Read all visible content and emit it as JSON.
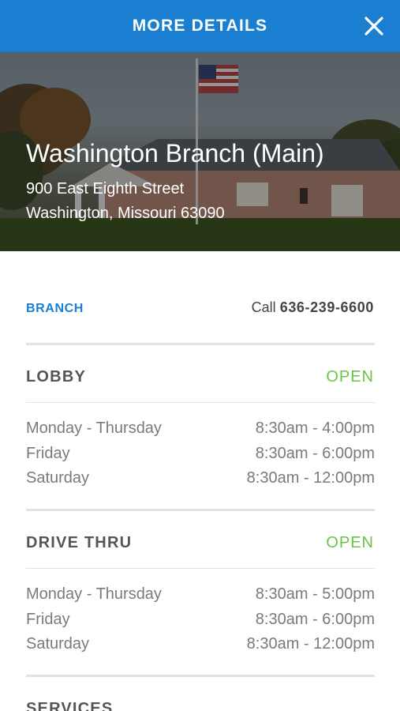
{
  "header": {
    "title": "MORE DETAILS",
    "close_icon": "close-icon"
  },
  "branch": {
    "name": "Washington Branch (Main)",
    "address_line1": "900 East Eighth Street",
    "address_line2": "Washington, Missouri 63090",
    "tag": "BRANCH",
    "call_label": "Call",
    "phone": "636-239-6600"
  },
  "colors": {
    "accent": "#1a7fd0",
    "open": "#6cc24a",
    "text": "#555555",
    "muted": "#7a7a7a",
    "divider": "#e2e2e2"
  },
  "sections": {
    "lobby": {
      "title": "LOBBY",
      "status": "OPEN",
      "hours": [
        {
          "days": "Monday - Thursday",
          "time": "8:30am - 4:00pm"
        },
        {
          "days": "Friday",
          "time": "8:30am - 6:00pm"
        },
        {
          "days": "Saturday",
          "time": "8:30am - 12:00pm"
        }
      ]
    },
    "drive_thru": {
      "title": "DRIVE THRU",
      "status": "OPEN",
      "hours": [
        {
          "days": "Monday - Thursday",
          "time": "8:30am - 5:00pm"
        },
        {
          "days": "Friday",
          "time": "8:30am - 6:00pm"
        },
        {
          "days": "Saturday",
          "time": "8:30am - 12:00pm"
        }
      ]
    },
    "services": {
      "title": "SERVICES"
    }
  }
}
